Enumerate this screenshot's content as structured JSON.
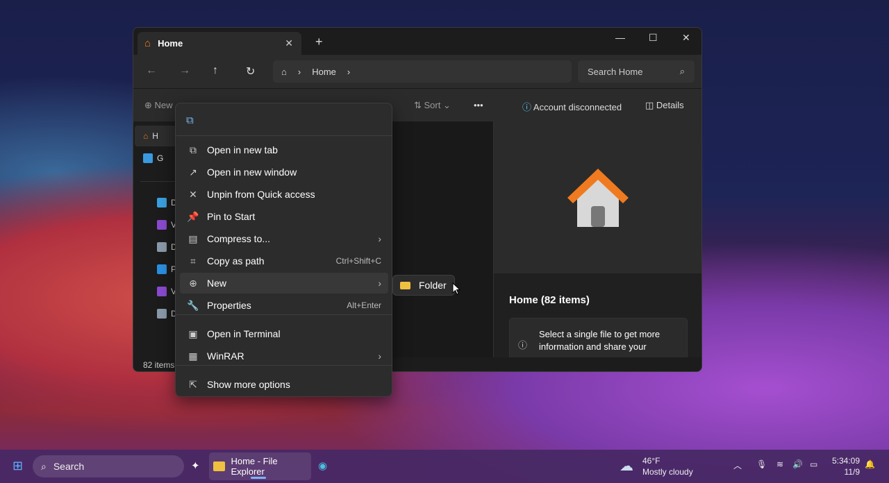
{
  "window": {
    "tab_title": "Home",
    "breadcrumb": [
      "Home"
    ],
    "search_placeholder": "Search Home"
  },
  "toolbar": {
    "new_label": "New",
    "sort_label": "Sort",
    "more_label": "•••",
    "account_status": "Account disconnected",
    "details_label": "Details"
  },
  "sidebar": {
    "items": [
      "H",
      "G",
      "D",
      "V",
      "D",
      "P",
      "V",
      "D"
    ]
  },
  "details": {
    "title": "Home (82 items)",
    "info_text": "Select a single file to get more information and share your"
  },
  "status": {
    "items_count": "82 items"
  },
  "context_menu": {
    "items": [
      {
        "label": "Open in new tab",
        "icon": "open-new-tab-icon"
      },
      {
        "label": "Open in new window",
        "icon": "open-new-window-icon"
      },
      {
        "label": "Unpin from Quick access",
        "icon": "unpin-icon"
      },
      {
        "label": "Pin to Start",
        "icon": "pin-icon"
      },
      {
        "label": "Compress to...",
        "icon": "compress-icon",
        "submenu": true
      },
      {
        "label": "Copy as path",
        "icon": "copy-path-icon",
        "shortcut": "Ctrl+Shift+C"
      },
      {
        "label": "New",
        "icon": "plus-circle-icon",
        "submenu": true,
        "highlighted": true
      },
      {
        "label": "Properties",
        "icon": "wrench-icon",
        "shortcut": "Alt+Enter"
      },
      {
        "label": "Open in Terminal",
        "icon": "terminal-icon"
      },
      {
        "label": "WinRAR",
        "icon": "winrar-icon",
        "submenu": true
      },
      {
        "label": "Show more options",
        "icon": "more-options-icon"
      }
    ],
    "submenu": {
      "label": "Folder"
    }
  },
  "taskbar": {
    "search_label": "Search",
    "app_label": "Home - File Explorer",
    "weather_temp": "46°F",
    "weather_desc": "Mostly cloudy",
    "time": "5:34:09",
    "date": "11/9"
  },
  "colors": {
    "accent": "#60cdff",
    "taskbar": "#46286a",
    "home_icon": "#f07a20"
  }
}
